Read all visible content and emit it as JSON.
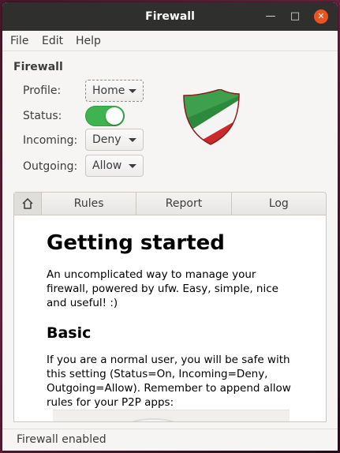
{
  "window": {
    "title": "Firewall"
  },
  "menu": {
    "file": "File",
    "edit": "Edit",
    "help": "Help"
  },
  "panel": {
    "section": "Firewall",
    "profile_label": "Profile:",
    "profile_value": "Home",
    "status_label": "Status:",
    "status_on": true,
    "incoming_label": "Incoming:",
    "incoming_value": "Deny",
    "outgoing_label": "Outgoing:",
    "outgoing_value": "Allow"
  },
  "tabs": {
    "home_icon": "home-icon",
    "rules": "Rules",
    "report": "Report",
    "log": "Log"
  },
  "content": {
    "heading": "Getting started",
    "intro": "An uncomplicated way to manage your firewall, powered by ufw. Easy, simple, nice and useful! :)",
    "basic_heading": "Basic",
    "basic_text": "If you are a normal user, you will be safe with this setting (Status=On, Incoming=Deny, Outgoing=Allow). Remember to append allow rules for your P2P apps:"
  },
  "status_text": "Firewall enabled",
  "colors": {
    "switch_on": "#3eb34f",
    "close_button": "#e95420",
    "titlebar": "#2f2f2d"
  }
}
